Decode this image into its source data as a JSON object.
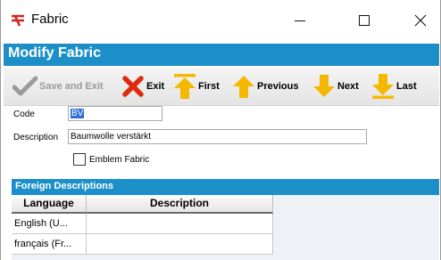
{
  "window": {
    "title": "Fabric"
  },
  "header": {
    "title": "Modify Fabric"
  },
  "toolbar": {
    "save_exit_label": "Save and Exit",
    "exit_label": "Exit",
    "first_label": "First",
    "previous_label": "Previous",
    "next_label": "Next",
    "last_label": "Last"
  },
  "form": {
    "code_label": "Code",
    "code_value": "BV",
    "description_label": "Description",
    "description_value": "Baumwolle verstärkt",
    "emblem_label": "Emblem Fabric",
    "emblem_checked": false
  },
  "foreign": {
    "title": "Foreign Descriptions",
    "columns": [
      "Language",
      "Description"
    ],
    "rows": [
      {
        "language": "English (U...",
        "description": ""
      },
      {
        "language": "français (Fr...",
        "description": ""
      }
    ]
  },
  "colors": {
    "accent": "#1c8fc9",
    "arrow": "#f5b800",
    "exit": "#e02a10",
    "disabled": "#9a9a9a"
  }
}
